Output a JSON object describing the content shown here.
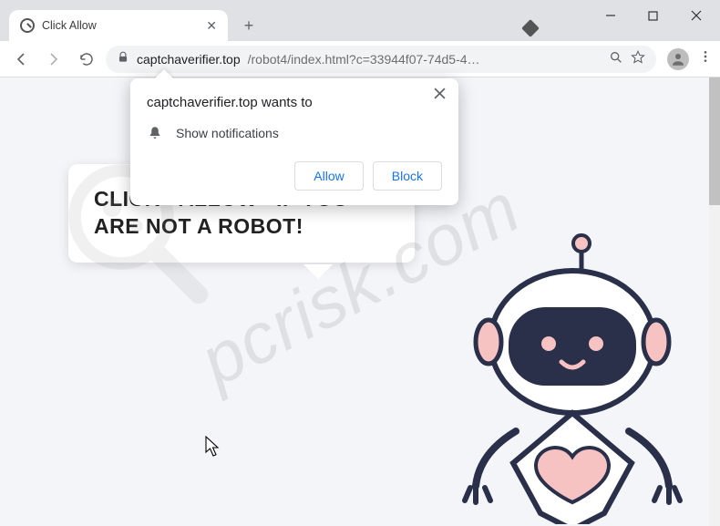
{
  "window": {
    "tab_title": "Click Allow",
    "minimize": "—",
    "maximize": "☐",
    "close": "✕"
  },
  "toolbar": {
    "url_domain": "captchaverifier.top",
    "url_path": "/robot4/index.html?c=33944f07-74d5-4…"
  },
  "popup": {
    "title": "captchaverifier.top wants to",
    "message": "Show notifications",
    "allow": "Allow",
    "block": "Block",
    "close": "✕"
  },
  "page": {
    "speech_line1": "CLICK «ALLOW» IF YOU",
    "speech_line2": "ARE NOT A ROBOT!"
  },
  "watermark": {
    "text": "pcrisk.com"
  }
}
